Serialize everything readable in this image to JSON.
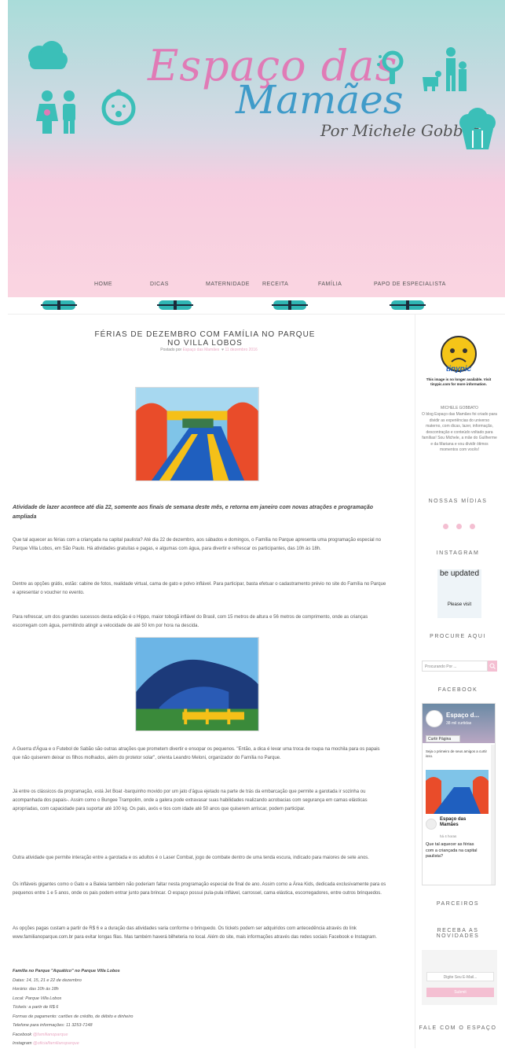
{
  "header": {
    "logo_line1": "Espaço das",
    "logo_line2": "Mamães",
    "logo_sub": "Por Michele Gobbato",
    "colors": {
      "teal": "#3bbfb8",
      "pink": "#e07bb6",
      "blue": "#3f9bc9"
    }
  },
  "nav": {
    "items": [
      "HOME",
      "DICAS",
      "MATERNIDADE",
      "RECEITA",
      "FAMÍLIA",
      "PAPO DE ESPECIALISTA"
    ]
  },
  "post": {
    "title": "FÉRIAS DE DEZEMBRO COM FAMÍLIA NO PARQUE NO VILLA LOBOS",
    "meta_prefix": "Postado por",
    "meta_author": "Espaço das Mamães",
    "meta_date": "11 dezembro 2016",
    "lead": "Atividade de lazer acontece até dia 22, somente aos finais de semana deste mês, e retorna em janeiro com novas atrações e programação ampliada",
    "p1": "Que tal aquecer as férias com a criançada na capital paulista? Até dia 22 de dezembro, aos sábados e domingos, o Família no Parque apresenta uma programação especial no Parque Villa Lobos, em São Paulo. Há atividades gratuitas e pagas, e algumas com água, para divertir e refrescar os participantes, das 10h às 18h.",
    "p2": "Dentre as opções grátis, estão: cabine de fotos, realidade virtual, cama de gato e polvo inflável. Para participar, basta efetuar o cadastramento prévio no site do Família no Parque e apresentar o voucher no evento.",
    "p3": "Para refrescar, um dos grandes sucessos desta edição é o Hippo, maior tobogã inflável do Brasil, com 15 metros de altura e 56 metros de comprimento, onde as crianças escorregam com água, permitindo atingir a velocidade de até 50 km por hora na descida.",
    "p4": "A Guerra d'Água e o Futebol de Sabão são outras atrações que prometem divertir e ensopar os pequenos. \"Então, a dica é levar uma troca de roupa na mochila para os papais que não quiserem deixar os filhos molhados, além do protetor solar\", orienta Leandro Meloni, organizador do Família no Parque.",
    "p5": "Já entre os clássicos da programação, está Jet Boat -barquinho movido por um jato d'água ejetado na parte de trás da embarcação que permite a garotada ir sozinha ou acompanhada dos papais-. Assim como o Bungee Trampolim, onde a galera pode extravasar suas habilidades realizando acrobacias com segurança em camas elásticas apropriadas, com capacidade para suportar até 100 kg. Os pais, avós e tios com idade até 50 anos que quiserem arriscar, podem participar.",
    "p6": "Outra atividade que permite interação entre a garotada e os adultos é o Laser Combat, jogo de combate dentro de uma tenda escura, indicado para maiores de sete anos.",
    "p7": "Os infláveis gigantes como o Gato e a Baleia também não poderiam faltar nesta programação especial de final de ano. Assim como a Área Kids, dedicada exclusivamente para os pequenos entre 1 e 5 anos, onde os pais podem entrar junto para brincar. O espaço possui pula-pula inflável, carrossel, cama elástica, escorregadores, entre outros brinquedos.",
    "p8": "As opções pagas custam a partir de R$ 6 e a duração das atividades varia conforme o brinquedo. Os tickets podem ser adquiridos com antecedência através do link www.familianoparque.com.br para evitar longas filas. Mas também haverá bilheteria no local. Além do site, mais informações através das redes sociais Facebook e Instagram.",
    "info_title": "Família no Parque \"Aquático\" no Parque Villa Lobos",
    "info_lines": [
      "Datas: 14, 15, 21 e 22 de dezembro",
      "Horário: das 10h às 18h",
      "Local: Parque Villa Lobos",
      "Tickets: a partir de R$ 6",
      "Formas de pagamento: cartões de crédito, de débito e dinheiro",
      "Telefone para informações: 11 3253-7148"
    ],
    "info_fb_label": "Facebook",
    "info_fb_handle": "@familianoparque",
    "info_ig_label": "Instagram",
    "info_ig_handle": "@oficialfamilianoparque"
  },
  "sidebar": {
    "tinypic_notice": "This image is no longer available. Visit tinypic.com for more information.",
    "tinypic_logo": "tinypic",
    "about_name": "MICHELE GOBBATO",
    "about_text": "O blog Espaço das Mamães foi criado para dividir as experiências do universo materno, com dicas, lazer, informação, descontração e conteúdo voltado para famílias! Sou Michele, a mãe do Guilherme e da Mariana e vou dividir ótimos momentos com vocês!",
    "midias_title": "NOSSAS MÍDIAS",
    "instagram_title": "INSTAGRAM",
    "instagram_widget_top": "be updated",
    "instagram_widget_bottom": "Please visit",
    "procure_title": "PROCURE AQUI",
    "search_placeholder": "Procurando Por ...",
    "facebook_title": "FACEBOOK",
    "fb_page_name": "Espaço d...",
    "fb_likes": "38 mil curtidas",
    "fb_like_button": "Curtir Página",
    "fb_first_friend": "Seja o primeiro de seus amigos a curtir isso.",
    "fb_post_author": "Espaço das Mamães",
    "fb_post_time": "há 4 horas",
    "fb_post_text": "Que tal aquecer as férias com a criançada na capital paulista?",
    "parceiros_title": "PARCEIROS",
    "newsletter_title": "RECEBA AS NOVIDADES",
    "email_placeholder": "Digite Seu E-Mail...",
    "submit_label": "Submit",
    "contact_title": "FALE COM O ESPAÇO"
  }
}
